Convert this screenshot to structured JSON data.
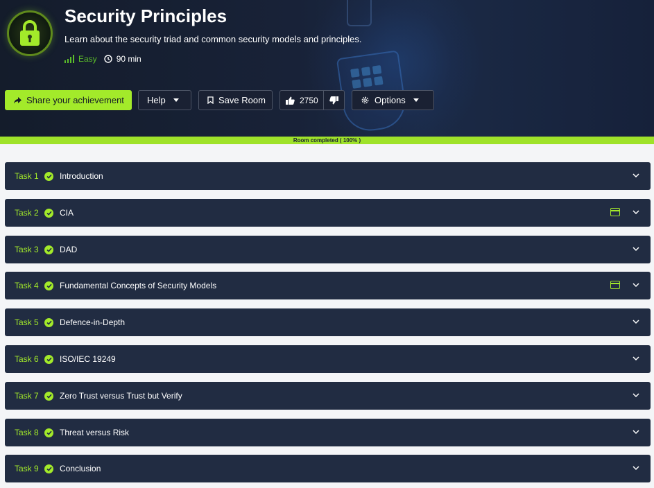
{
  "room": {
    "title": "Security Principles",
    "description": "Learn about the security triad and common security models and principles.",
    "difficulty": "Easy",
    "duration": "90 min"
  },
  "toolbar": {
    "share_label": "Share your achievement",
    "help_label": "Help",
    "save_label": "Save Room",
    "like_count": "2750",
    "options_label": "Options"
  },
  "progress": {
    "label": "Room completed ( 100% )",
    "percent": 100
  },
  "tasks": [
    {
      "number": "Task 1",
      "title": "Introduction",
      "has_machine": false,
      "completed": true
    },
    {
      "number": "Task 2",
      "title": "CIA",
      "has_machine": true,
      "completed": true
    },
    {
      "number": "Task 3",
      "title": "DAD",
      "has_machine": false,
      "completed": true
    },
    {
      "number": "Task 4",
      "title": "Fundamental Concepts of Security Models",
      "has_machine": true,
      "completed": true
    },
    {
      "number": "Task 5",
      "title": "Defence-in-Depth",
      "has_machine": false,
      "completed": true
    },
    {
      "number": "Task 6",
      "title": "ISO/IEC 19249",
      "has_machine": false,
      "completed": true
    },
    {
      "number": "Task 7",
      "title": "Zero Trust versus Trust but Verify",
      "has_machine": false,
      "completed": true
    },
    {
      "number": "Task 8",
      "title": "Threat versus Risk",
      "has_machine": false,
      "completed": true
    },
    {
      "number": "Task 9",
      "title": "Conclusion",
      "has_machine": false,
      "completed": true
    }
  ],
  "colors": {
    "accent": "#a3ea2a",
    "easy": "#5bbd2a",
    "task_bg": "#212c42",
    "hero_bg": "#182238"
  },
  "icons": {
    "room": "padlock-icon",
    "difficulty": "signal-bars-icon",
    "duration": "clock-icon",
    "share": "share-arrow-icon",
    "save": "bookmark-icon",
    "like": "thumbs-up-icon",
    "dislike": "thumbs-down-icon",
    "options": "gear-icon",
    "task_status": "check-circle-icon",
    "machine": "browser-window-icon",
    "expand": "chevron-down-icon"
  }
}
